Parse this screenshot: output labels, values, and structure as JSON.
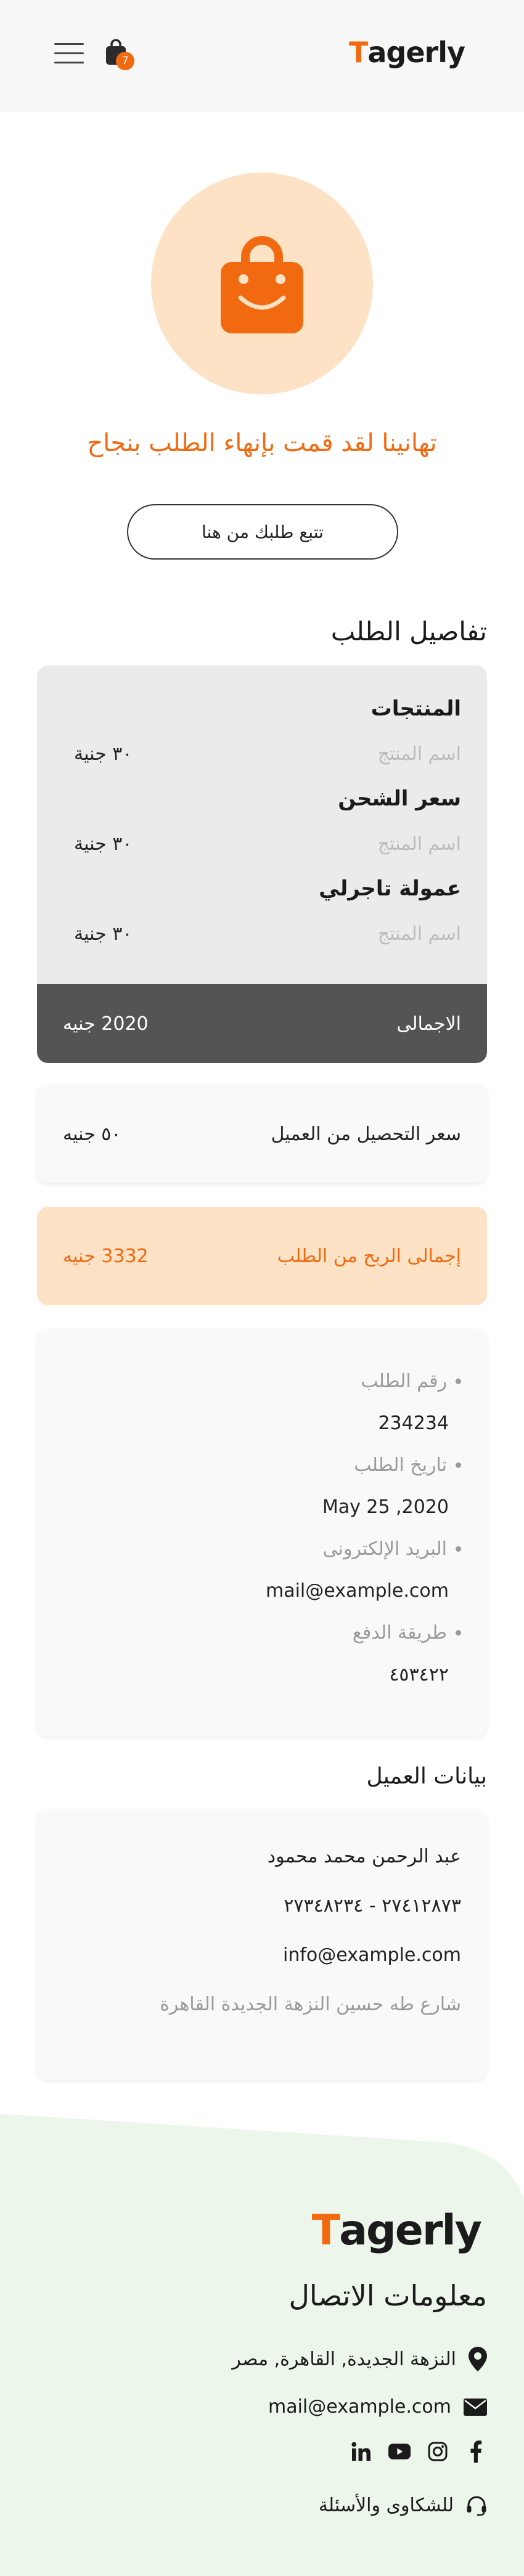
{
  "header": {
    "logo_mark": "T",
    "logo_text": "agerly",
    "cart_count": "7"
  },
  "success": {
    "title": "تهانينا لقد قمت بإنهاء الطلب بنجاح",
    "track_button": "تتبع طلبك من هنا"
  },
  "order_details": {
    "title": "تفاصيل الطلب",
    "sections": [
      {
        "heading": "المنتجات",
        "name": "اسم المنتج",
        "price": "٣٠ جنية"
      },
      {
        "heading": "سعر الشحن",
        "name": "اسم المنتج",
        "price": "٣٠ جنية"
      },
      {
        "heading": "عمولة تاجرلي",
        "name": "اسم المنتج",
        "price": "٣٠ جنية"
      }
    ],
    "total_label": "الاجمالى",
    "total_value": "2020 جنيه"
  },
  "collection": {
    "label": "سعر التحصيل من العميل",
    "value": "٥٠ جنيه"
  },
  "profit": {
    "label": "إجمالى الربح من الطلب",
    "value": "3332 جنيه"
  },
  "order_info": [
    {
      "label": "رقم الطلب",
      "value": "234234"
    },
    {
      "label": "تاريخ الطلب",
      "value": "May 25 ,2020"
    },
    {
      "label": "البريد الإلكترونى",
      "value": "mail@example.com"
    },
    {
      "label": "طريقة الدفع",
      "value": "٤٥٣٤٢٢"
    }
  ],
  "customer": {
    "title": "بيانات العميل",
    "name": "عبد الرحمن محمد محمود",
    "phones": "٢٧٤١٢٨٧٣ - ٢٧٣٤٨٢٣٤",
    "email": "info@example.com",
    "address": "شارع طه حسين النزهة الجديدة القاهرة"
  },
  "footer": {
    "logo_mark": "T",
    "logo_text": "agerly",
    "contact_title": "معلومات الاتصال",
    "address": "النزهة الجديدة, القاهرة, مصر",
    "email": "mail@example.com",
    "complaints": "للشكاوى والأسئلة"
  },
  "colors": {
    "accent": "#f26a10",
    "accent_light": "#fde2c5",
    "dark": "#545454",
    "footer_bg": "#ecf6ea"
  }
}
